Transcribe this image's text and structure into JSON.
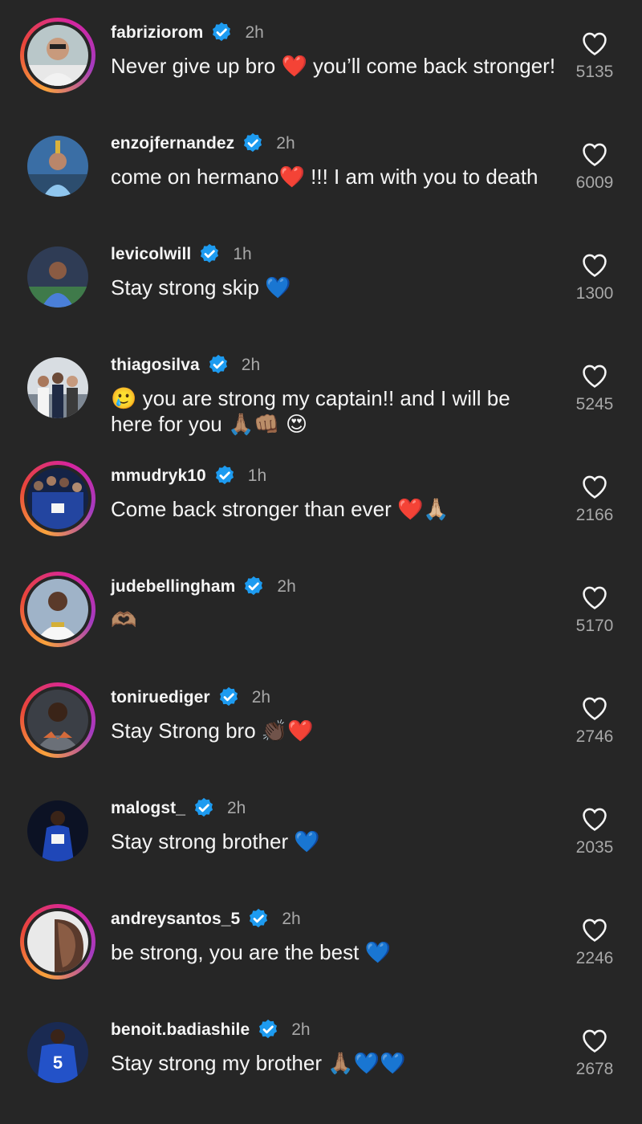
{
  "theme": {
    "background": "#262626",
    "verified_color": "#1d9bf0",
    "muted_text": "#a8a8a8"
  },
  "comments": [
    {
      "username": "fabriziorom",
      "time": "2h",
      "text": "Never give up bro ❤️ you’ll come back stronger!",
      "likes": "5135",
      "avatar_ring": "story",
      "avatar_icon": "avatar-photo"
    },
    {
      "username": "enzojfernandez",
      "time": "2h",
      "text": "come on hermano❤️ !!! I am with you to death",
      "likes": "6009",
      "avatar_ring": "none",
      "avatar_icon": "avatar-photo"
    },
    {
      "username": "levicolwill",
      "time": "1h",
      "text": "Stay strong skip 💙",
      "likes": "1300",
      "avatar_ring": "none",
      "avatar_icon": "avatar-photo"
    },
    {
      "username": "thiagosilva",
      "time": "2h",
      "text": "🥲 you are strong my captain!! and I will be here for you 🙏🏽👊🏽 😍",
      "likes": "5245",
      "avatar_ring": "none",
      "avatar_icon": "avatar-photo"
    },
    {
      "username": "mmudryk10",
      "time": "1h",
      "text": "Come  back stronger than ever ❤️🙏🏼",
      "likes": "2166",
      "avatar_ring": "story",
      "avatar_icon": "avatar-photo"
    },
    {
      "username": "judebellingham",
      "time": "2h",
      "text": "🫶🏽",
      "likes": "5170",
      "avatar_ring": "story",
      "avatar_icon": "avatar-photo"
    },
    {
      "username": "toniruediger",
      "time": "2h",
      "text": "Stay Strong bro 👏🏿❤️",
      "likes": "2746",
      "avatar_ring": "story",
      "avatar_icon": "avatar-photo"
    },
    {
      "username": "malogst_",
      "time": "2h",
      "text": "Stay strong brother 💙",
      "likes": "2035",
      "avatar_ring": "none",
      "avatar_icon": "avatar-photo"
    },
    {
      "username": "andreysantos_5",
      "time": "2h",
      "text": "be strong, you are the best 💙",
      "likes": "2246",
      "avatar_ring": "story",
      "avatar_icon": "avatar-photo"
    },
    {
      "username": "benoit.badiashile",
      "time": "2h",
      "text": "Stay strong my brother 🙏🏽💙💙",
      "likes": "2678",
      "avatar_ring": "none",
      "avatar_icon": "avatar-photo"
    }
  ]
}
